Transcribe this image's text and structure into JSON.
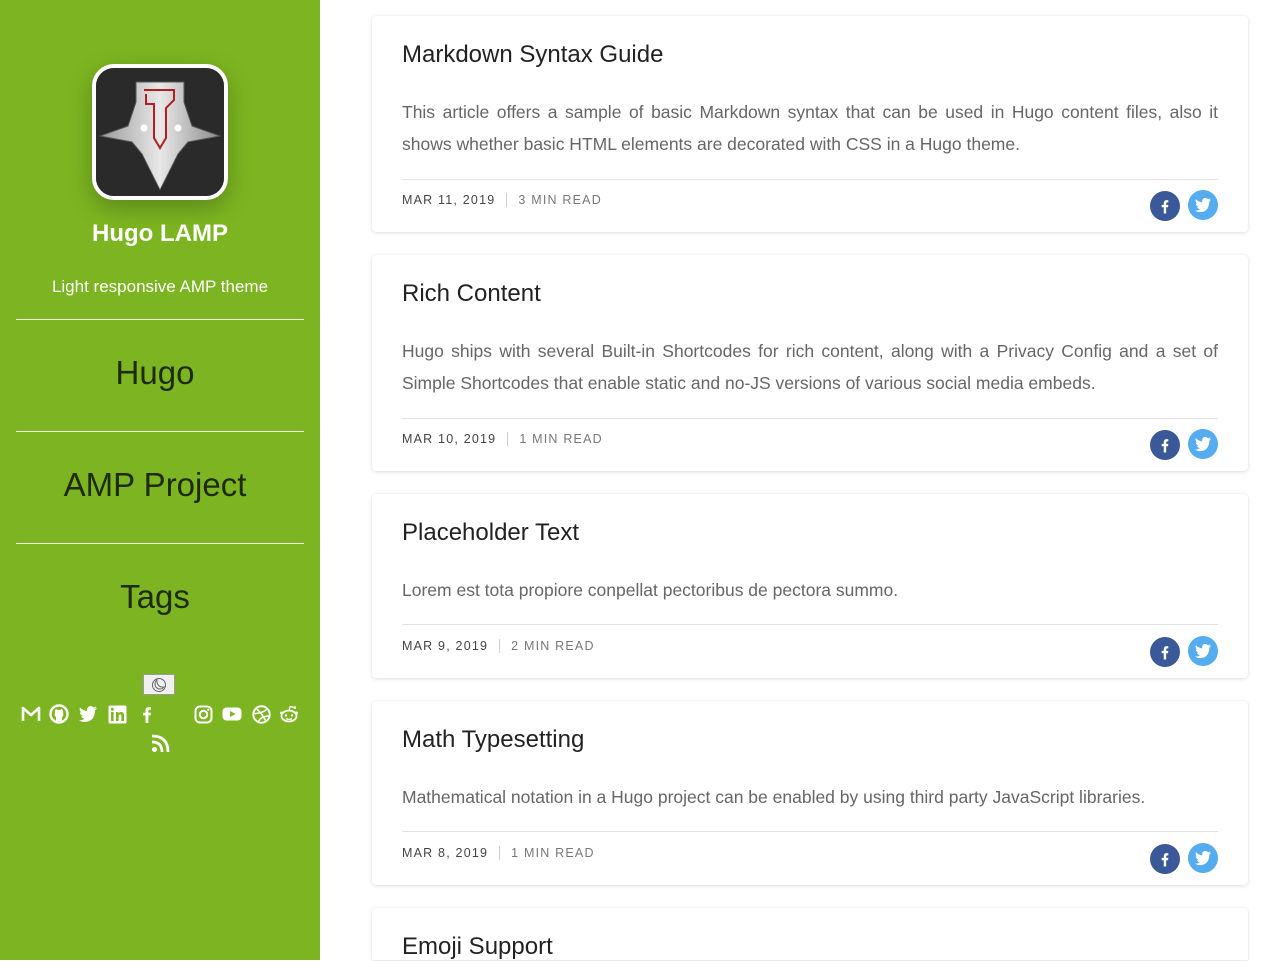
{
  "sidebar": {
    "title": "Hugo LAMP",
    "description": "Light responsive AMP theme",
    "menu": [
      {
        "label": "Hugo"
      },
      {
        "label": "AMP Project"
      },
      {
        "label": "Tags"
      }
    ],
    "theme_toggle_icon": "moon-icon",
    "social_icons": [
      "gmail-icon",
      "github-icon",
      "twitter-icon",
      "linkedin-icon",
      "facebook-icon",
      "instagram-icon",
      "youtube-icon",
      "dribbble-icon",
      "reddit-icon",
      "rss-icon"
    ],
    "accent_color": "#7cb521"
  },
  "posts": [
    {
      "title": "Markdown Syntax Guide",
      "summary": "This article offers a sample of basic Markdown syntax that can be used in Hugo content files, also it shows whether basic HTML elements are decorated with CSS in a Hugo theme.",
      "date": "MAR 11, 2019",
      "read_time": "3 MIN READ"
    },
    {
      "title": "Rich Content",
      "summary": "Hugo ships with several Built-in Shortcodes for rich content, along with a Privacy Config and a set of Simple Shortcodes that enable static and no-JS versions of various social media embeds.",
      "date": "MAR 10, 2019",
      "read_time": "1 MIN READ"
    },
    {
      "title": "Placeholder Text",
      "summary": "Lorem est tota propiore conpellat pectoribus de pectora summo.",
      "date": "MAR 9, 2019",
      "read_time": "2 MIN READ"
    },
    {
      "title": "Math Typesetting",
      "summary": "Mathematical notation in a Hugo project can be enabled by using third party JavaScript libraries.",
      "date": "MAR 8, 2019",
      "read_time": "1 MIN READ"
    },
    {
      "title": "Emoji Support"
    }
  ],
  "share_colors": {
    "facebook": "#3b5998",
    "twitter": "#55acee"
  }
}
